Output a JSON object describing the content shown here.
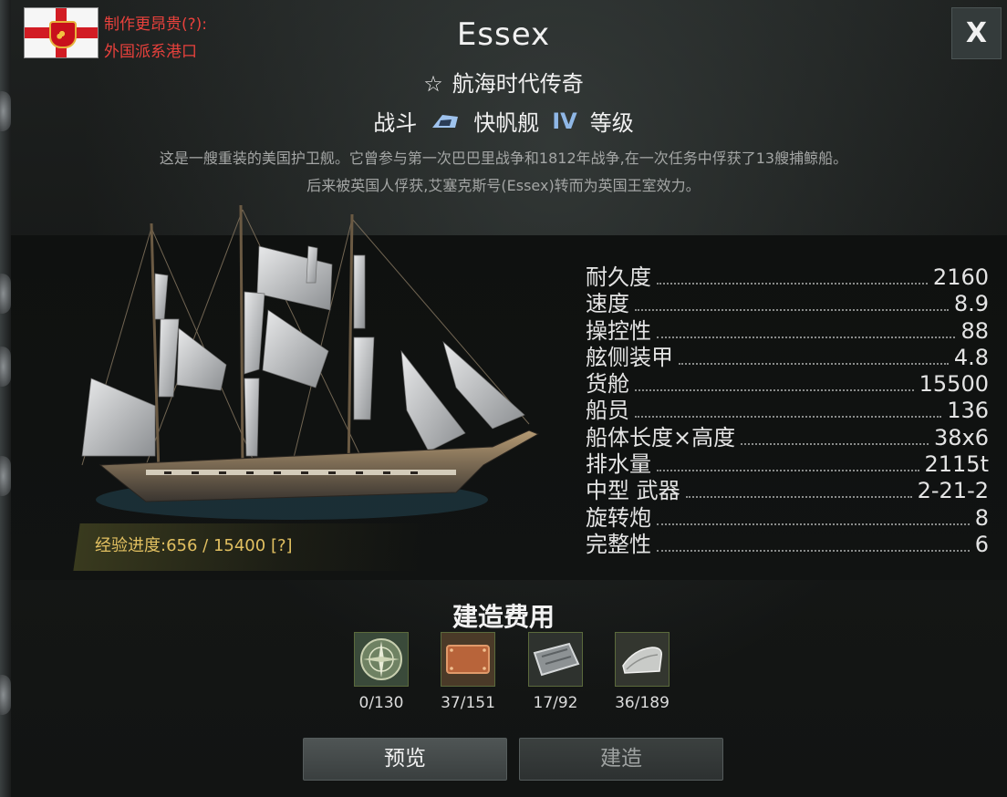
{
  "header": {
    "faction_cost_note": "制作更昂贵(?):",
    "faction_port": "外国派系港口",
    "ship_name": "Essex",
    "legend_star": "☆",
    "legend_label": "航海时代传奇",
    "role": "战斗",
    "ship_class": "快帆舰",
    "tier_roman": "IV",
    "tier_label": "等级",
    "close_label": "X"
  },
  "description": {
    "line1": "这是一艘重装的美国护卫舰。它曾参与第一次巴巴里战争和1812年战争,在一次任务中俘获了13艘捕鲸船。",
    "line2": "后来被英国人俘获,艾塞克斯号(Essex)转而为英国王室效力。"
  },
  "experience": {
    "label": "经验进度:",
    "current": "656",
    "separator": " / ",
    "max": "15400",
    "help": " [?]"
  },
  "stats": [
    {
      "label": "耐久度",
      "value": "2160"
    },
    {
      "label": "速度",
      "value": "8.9"
    },
    {
      "label": "操控性",
      "value": "88"
    },
    {
      "label": "舷侧装甲",
      "value": "4.8"
    },
    {
      "label": "货舱",
      "value": "15500"
    },
    {
      "label": "船员",
      "value": "136"
    },
    {
      "label": "船体长度×高度",
      "value": "38x6"
    },
    {
      "label": "排水量",
      "value": "2115t"
    },
    {
      "label": "中型 武器",
      "value": "2-21-2"
    },
    {
      "label": "旋转炮",
      "value": "8"
    },
    {
      "label": "完整性",
      "value": "6"
    }
  ],
  "build_cost": {
    "title": "建造费用",
    "resources": [
      {
        "icon": "map-compass-icon",
        "count": "0/130"
      },
      {
        "icon": "copper-plate-icon",
        "count": "37/151"
      },
      {
        "icon": "iron-plate-icon",
        "count": "17/92"
      },
      {
        "icon": "canvas-icon",
        "count": "36/189"
      }
    ]
  },
  "buttons": {
    "preview": "预览",
    "build": "建造"
  },
  "colors": {
    "faction_text": "#e8413c",
    "tier": "#8fb7e6",
    "xp_text": "#e2c061"
  }
}
